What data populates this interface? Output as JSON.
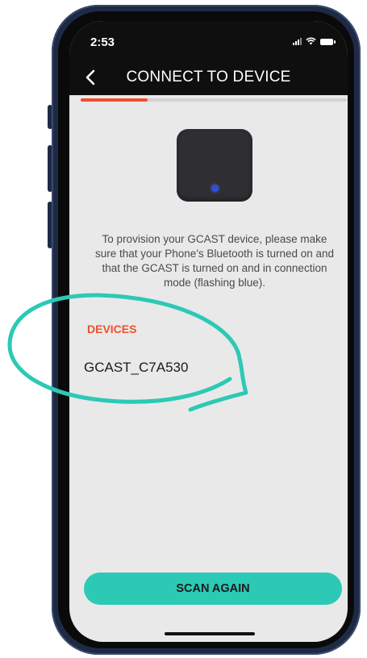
{
  "status_bar": {
    "time": "2:53",
    "icons": [
      "signal-icon",
      "wifi-icon",
      "battery-icon"
    ]
  },
  "header": {
    "back_icon": "chevron-left-icon",
    "title": "CONNECT TO DEVICE"
  },
  "progress": {
    "fraction": 0.25,
    "color": "#f0502d"
  },
  "device_image": {
    "led_color": "#2f4fd4"
  },
  "instructions": "To provision your GCAST device, please make sure that your Phone's Bluetooth is turned on and that the GCAST is turned on and in connection mode (flashing blue).",
  "devices": {
    "heading": "DEVICES",
    "items": [
      "GCAST_C7A530"
    ]
  },
  "scan_button": {
    "label": "SCAN AGAIN",
    "color": "#2cc9b5"
  },
  "colors": {
    "accent": "#f0502d",
    "annotation": "#2cc9b5",
    "header_bg": "#0f0f0f",
    "screen_bg": "#e9e9e9"
  }
}
